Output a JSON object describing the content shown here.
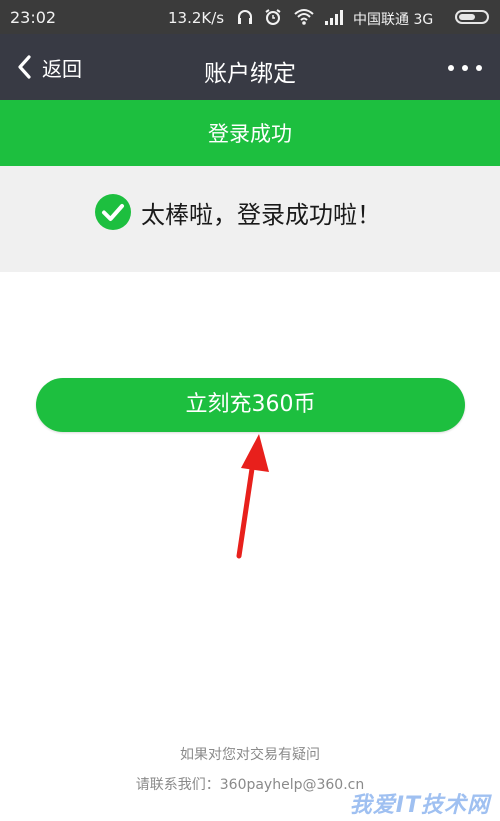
{
  "status_bar": {
    "time": "23:02",
    "speed": "13.2K/s",
    "carrier": "中国联通 3G",
    "battery_level": 0.6
  },
  "header": {
    "back_label": "返回",
    "title": "账户绑定"
  },
  "banner": {
    "text": "登录成功"
  },
  "message": {
    "text": "太棒啦，登录成功啦！"
  },
  "main": {
    "recharge_button_label": "立刻充360币"
  },
  "footer": {
    "line1": "如果对您对交易有疑问",
    "line2": "请联系我们：360payhelp@360.cn"
  },
  "watermark": {
    "text": "我爱IT技术网"
  },
  "colors": {
    "status_bar_bg": "#3b3b3b",
    "header_bg": "#383a44",
    "accent_green": "#1dbf3f",
    "message_bg": "#f0f0f0",
    "annotation_red": "#e8201c"
  }
}
